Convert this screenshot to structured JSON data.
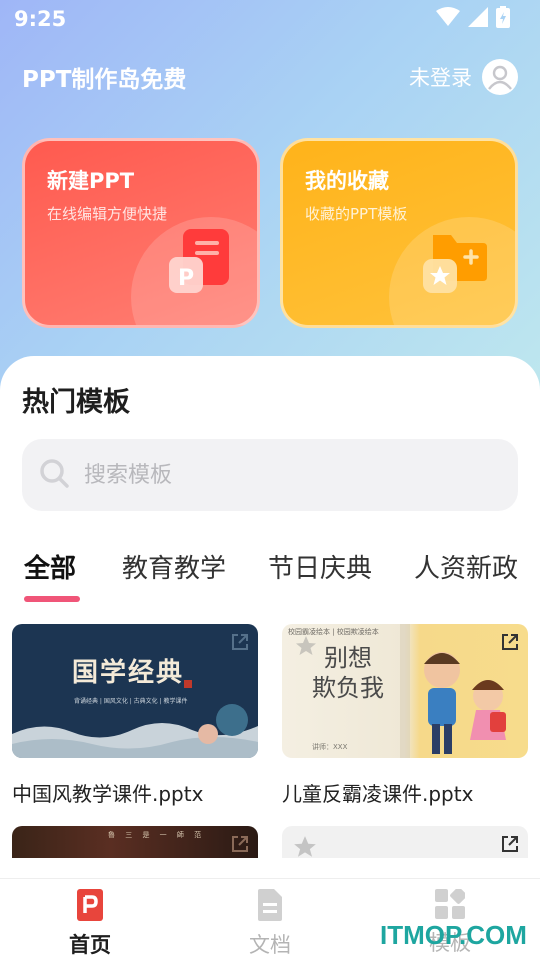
{
  "status_bar": {
    "time": "9:25"
  },
  "header": {
    "app_title": "PPT制作岛免费",
    "login_label": "未登录"
  },
  "cards": [
    {
      "title": "新建PPT",
      "subtitle": "在线编辑方便快捷",
      "icon": "ppt-file-icon"
    },
    {
      "title": "我的收藏",
      "subtitle": "收藏的PPT模板",
      "icon": "favorite-folder-icon"
    }
  ],
  "section": {
    "title": "热门模板"
  },
  "search": {
    "placeholder": "搜索模板"
  },
  "tabs": [
    {
      "label": "全部",
      "active": true
    },
    {
      "label": "教育教学",
      "active": false
    },
    {
      "label": "节日庆典",
      "active": false
    },
    {
      "label": "人资新政",
      "active": false
    }
  ],
  "templates": [
    {
      "name": "中国风教学课件.pptx",
      "thumb_title": "国学经典",
      "thumb_sub": "背诵经典 | 国风文化 | 古典文化 | 教学课件"
    },
    {
      "name": "儿童反霸凌课件.pptx",
      "thumb_title_1": "别想",
      "thumb_title_2": "欺负我",
      "thumb_top": "校园霸凌绘本 | 校园欺凌绘本",
      "thumb_presenter": "讲师：XXX"
    },
    {
      "name": "",
      "thumb_top": "魯 三 是 一 師 范"
    },
    {
      "name": ""
    }
  ],
  "bottom_nav": [
    {
      "label": "首页",
      "icon": "home-ppt-icon",
      "active": true
    },
    {
      "label": "文档",
      "icon": "document-icon",
      "active": false
    },
    {
      "label": "模板",
      "icon": "grid-icon",
      "active": false
    }
  ],
  "watermark": "ITMOP.COM",
  "colors": {
    "accent_pink": "#f05578",
    "card_red": "#ff5a4f",
    "card_orange": "#ffb31a",
    "active_nav": "#e8453c"
  }
}
